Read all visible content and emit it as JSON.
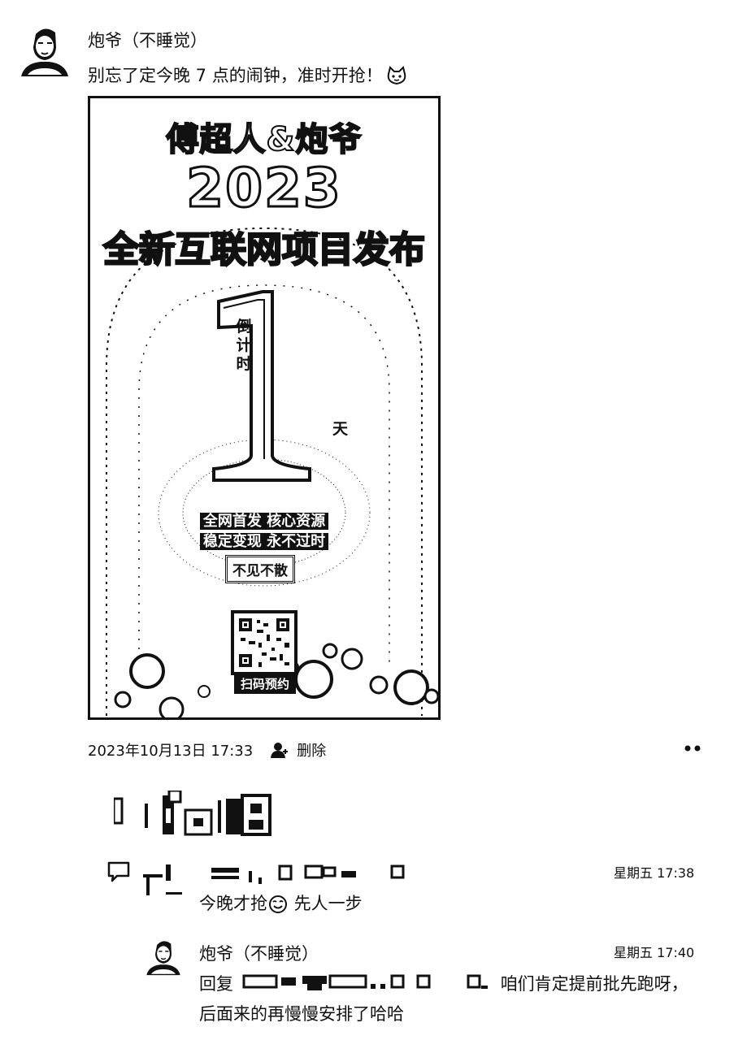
{
  "post": {
    "author_name": "炮爷（不睡觉）",
    "text": "别忘了定今晚 7 点的闹钟，准时开抢！",
    "timestamp": "2023年10月13日 17:33",
    "delete_label": "删除"
  },
  "poster_image": {
    "title_line1": "傅超人&炮爷",
    "title_year": "2023",
    "title_line3": "全新互联网项目发布",
    "countdown_label": "倒计时",
    "countdown_number": "1",
    "countdown_unit": "天",
    "slogan_line1": "全网首发 核心资源",
    "slogan_line2": "稳定变现 永不过时",
    "badge": "不见不散",
    "scan_label": "扫码预约"
  },
  "comments": [
    {
      "time": "星期五 17:38",
      "text_before_emoji": "今晚才抢",
      "text_after_emoji": " 先人一步"
    },
    {
      "author_name": "炮爷（不睡觉）",
      "time": "星期五 17:40",
      "reply_prefix": "回复",
      "text_after_name": "咱们肯定提前批先跑呀，后面来的再慢慢安排了哈哈"
    }
  ],
  "icons": {
    "post_emoji": "cat-face-icon",
    "comment_emoji": "smile-face-icon",
    "likes": "person-icon",
    "comment": "comment-bubble-icon",
    "more": "more-dots-icon"
  }
}
